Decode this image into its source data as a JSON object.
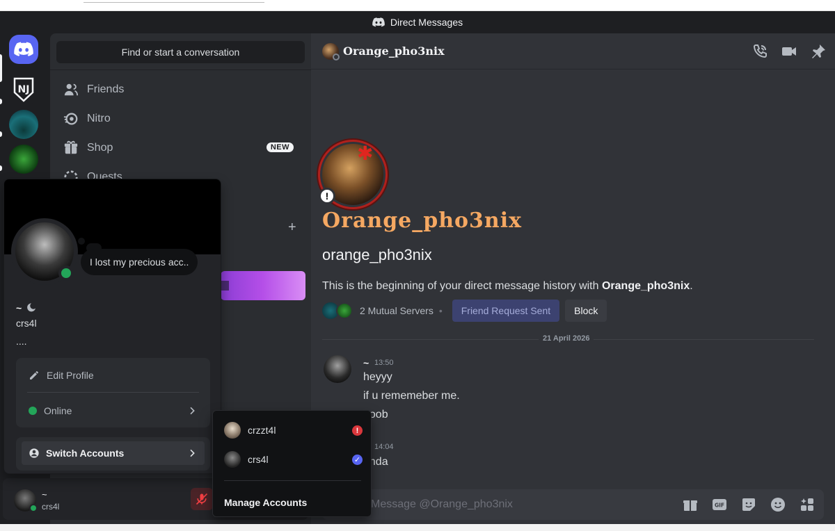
{
  "window": {
    "title": "Direct Messages"
  },
  "sidebar": {
    "search_placeholder": "Find or start a conversation",
    "nav": [
      {
        "label": "Friends",
        "icon": "friends-icon"
      },
      {
        "label": "Nitro",
        "icon": "nitro-icon"
      },
      {
        "label": "Shop",
        "icon": "shop-icon",
        "badge": "NEW"
      },
      {
        "label": "Quests",
        "icon": "quests-icon"
      }
    ]
  },
  "user_panel": {
    "name": "~",
    "tag": "crs4l"
  },
  "profile_popout": {
    "status_bubble": "I lost my precious acc..",
    "display_name": "~",
    "username": "crs4l",
    "bio": "....",
    "edit_profile": "Edit Profile",
    "status": "Online",
    "switch_accounts": "Switch Accounts"
  },
  "switch_menu": {
    "accounts": [
      {
        "name": "crzzt4l",
        "badge": "!"
      },
      {
        "name": "crs4l",
        "badge": "✓"
      }
    ],
    "manage": "Manage Accounts"
  },
  "chat": {
    "header_name": "Orange_pho3nix",
    "display_name": "Orange_pho3nix",
    "username": "orange_pho3nix",
    "intro_prefix": "This is the beginning of your direct message history with ",
    "intro_name": "Orange_pho3nix",
    "intro_suffix": ".",
    "mutual_servers": "2 Mutual Servers",
    "friend_request_btn": "Friend Request Sent",
    "block_btn": "Block",
    "date_divider": "21 April 2026",
    "messages": [
      {
        "author": "~",
        "time": "13:50",
        "lines": [
          "heyyy",
          "if u rememeber me.",
          "noob"
        ]
      },
      {
        "time": "14:04",
        "lines": [
          "anda"
        ]
      }
    ],
    "composer_placeholder": "Message @Orange_pho3nix"
  },
  "colors": {
    "accent": "#5865f2",
    "online": "#23a559",
    "display_name": "#f5a862",
    "danger": "#da373c"
  }
}
